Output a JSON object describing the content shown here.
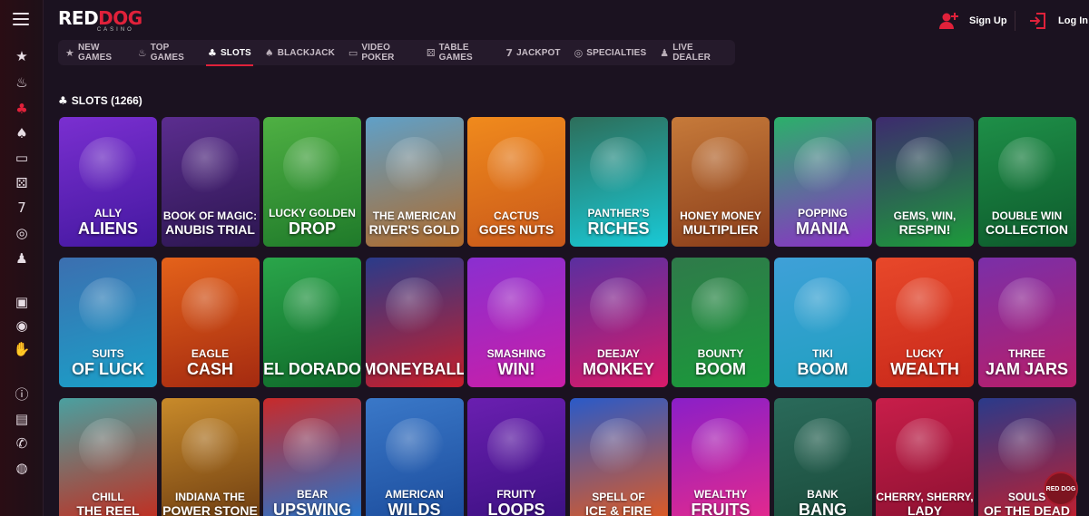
{
  "brand": {
    "logo_main_a": "RED",
    "logo_main_b": "DOG",
    "logo_sub": "CASINO"
  },
  "header": {
    "signup_label": "Sign Up",
    "login_label": "Log In"
  },
  "rail": {
    "items": [
      {
        "icon": "star-icon",
        "glyph": "★"
      },
      {
        "icon": "fire-icon",
        "glyph": "♨"
      },
      {
        "icon": "cherries-icon",
        "glyph": "♣",
        "active": true
      },
      {
        "icon": "spade-icon",
        "glyph": "♠"
      },
      {
        "icon": "monitor-icon",
        "glyph": "▭"
      },
      {
        "icon": "dice-icon",
        "glyph": "⚄"
      },
      {
        "icon": "sevens-icon",
        "glyph": "7"
      },
      {
        "icon": "chip-icon",
        "glyph": "◎"
      },
      {
        "icon": "dealer-icon",
        "glyph": "♟"
      },
      {
        "icon": "gift-icon",
        "glyph": "▣"
      },
      {
        "icon": "target-icon",
        "glyph": "◉"
      },
      {
        "icon": "hand-icon",
        "glyph": "✋"
      },
      {
        "icon": "info-icon",
        "glyph": "ⓘ"
      },
      {
        "icon": "wallet-icon",
        "glyph": "▤"
      },
      {
        "icon": "phone-icon",
        "glyph": "✆"
      },
      {
        "icon": "chat-icon",
        "glyph": "◍"
      }
    ]
  },
  "tabs": [
    {
      "label": "NEW GAMES",
      "icon": "star-icon",
      "glyph": "★"
    },
    {
      "label": "TOP GAMES",
      "icon": "fire-icon",
      "glyph": "♨"
    },
    {
      "label": "SLOTS",
      "icon": "cherries-icon",
      "glyph": "♣",
      "active": true
    },
    {
      "label": "BLACKJACK",
      "icon": "spade-icon",
      "glyph": "♠"
    },
    {
      "label": "VIDEO POKER",
      "icon": "monitor-icon",
      "glyph": "▭"
    },
    {
      "label": "TABLE GAMES",
      "icon": "dice-icon",
      "glyph": "⚄"
    },
    {
      "label": "JACKPOT",
      "icon": "sevens-icon",
      "glyph": "7"
    },
    {
      "label": "SPECIALTIES",
      "icon": "chip-icon",
      "glyph": "◎"
    },
    {
      "label": "LIVE DEALER",
      "icon": "dealer-icon",
      "glyph": "♟"
    }
  ],
  "section": {
    "title": "SLOTS (1266)"
  },
  "games": [
    {
      "l1": "ALLY",
      "l2": "ALIENS",
      "bg": "#7a2fd0",
      "bg2": "#4418a0"
    },
    {
      "l1": "BOOK OF MAGIC:",
      "l2": "ANUBIS TRIAL",
      "bg": "#5b2d8f",
      "bg2": "#2c1650",
      "sm": true
    },
    {
      "l1": "LUCKY GOLDEN",
      "l2": "DROP",
      "bg": "#4fb043",
      "bg2": "#1f7a2a"
    },
    {
      "l1": "THE AMERICAN",
      "l2": "RIVER'S GOLD",
      "bg": "#5fa0c8",
      "bg2": "#b06a2a",
      "sm": true
    },
    {
      "l1": "CACTUS",
      "l2": "GOES NUTS",
      "bg": "#f08a1c",
      "bg2": "#c9581a",
      "sm": true
    },
    {
      "l1": "PANTHER'S",
      "l2": "RICHES",
      "bg": "#2d6e5a",
      "bg2": "#19c9d6"
    },
    {
      "l1": "HONEY MONEY",
      "l2": "MULTIPLIER",
      "bg": "#c67a3a",
      "bg2": "#8a3d1a",
      "sm": true
    },
    {
      "l1": "POPPING",
      "l2": "MANIA",
      "bg": "#2bb06a",
      "bg2": "#8d2fc8"
    },
    {
      "l1": "GEMS, WIN,",
      "l2": "RESPIN!",
      "bg": "#3d2a6e",
      "bg2": "#1c9b3a",
      "sm": true
    },
    {
      "l1": "DOUBLE WIN",
      "l2": "COLLECTION",
      "bg": "#1e8f48",
      "bg2": "#0d5a2c",
      "sm": true
    },
    {
      "l1": "SUITS",
      "l2": "OF LUCK",
      "bg": "#3c6fb0",
      "bg2": "#1aa0c8"
    },
    {
      "l1": "EAGLE",
      "l2": "CASH",
      "bg": "#e4621a",
      "bg2": "#a42a10"
    },
    {
      "l1": "",
      "l2": "EL DORADO",
      "bg": "#2aa54a",
      "bg2": "#0f6a2a"
    },
    {
      "l1": "",
      "l2": "MONEYBALL",
      "bg": "#2a3b8a",
      "bg2": "#c81e2a"
    },
    {
      "l1": "SMASHING",
      "l2": "WIN!",
      "bg": "#8a2fd0",
      "bg2": "#c91ea8"
    },
    {
      "l1": "DEEJAY",
      "l2": "MONKEY",
      "bg": "#5a2fa0",
      "bg2": "#d81a6a"
    },
    {
      "l1": "BOUNTY",
      "l2": "BOOM",
      "bg": "#2f7a4a",
      "bg2": "#1a9a3a"
    },
    {
      "l1": "TIKI",
      "l2": "BOOM",
      "bg": "#3fa0d8",
      "bg2": "#1fa0c0"
    },
    {
      "l1": "LUCKY",
      "l2": "WEALTH",
      "bg": "#e8482a",
      "bg2": "#c8281a"
    },
    {
      "l1": "THREE",
      "l2": "JAM JARS",
      "bg": "#7a2fa8",
      "bg2": "#b81e6a"
    },
    {
      "l1": "CHILL",
      "l2": "THE REEL",
      "bg": "#4aa0a0",
      "bg2": "#c8281a",
      "sm": true
    },
    {
      "l1": "INDIANA THE",
      "l2": "POWER STONE",
      "bg": "#c88a2a",
      "bg2": "#6a3a10",
      "sm": true
    },
    {
      "l1": "BEAR",
      "l2": "UPSWING",
      "bg": "#c82a2a",
      "bg2": "#1a7ad8"
    },
    {
      "l1": "AMERICAN",
      "l2": "WILDS",
      "bg": "#3a78c8",
      "bg2": "#1a4a9a"
    },
    {
      "l1": "FRUITY",
      "l2": "LOOPS",
      "bg": "#6a1fb0",
      "bg2": "#3a1080"
    },
    {
      "l1": "SPELL OF",
      "l2": "ICE & FIRE",
      "bg": "#2a5ac8",
      "bg2": "#e85a1a",
      "sm": true
    },
    {
      "l1": "WEALTHY",
      "l2": "FRUITS",
      "bg": "#8a1fc8",
      "bg2": "#e82a8a"
    },
    {
      "l1": "BANK",
      "l2": "BANG",
      "bg": "#2a6a5a",
      "bg2": "#1a4a3a"
    },
    {
      "l1": "CHERRY, SHERRY,",
      "l2": "LADY",
      "bg": "#c81e4a",
      "bg2": "#8a1030",
      "sm": true
    },
    {
      "l1": "SOULS",
      "l2": "OF THE DEAD",
      "bg": "#2a3a8a",
      "bg2": "#c81e2a",
      "sm": true
    }
  ],
  "chat_badge": {
    "label": "RED DOG"
  }
}
